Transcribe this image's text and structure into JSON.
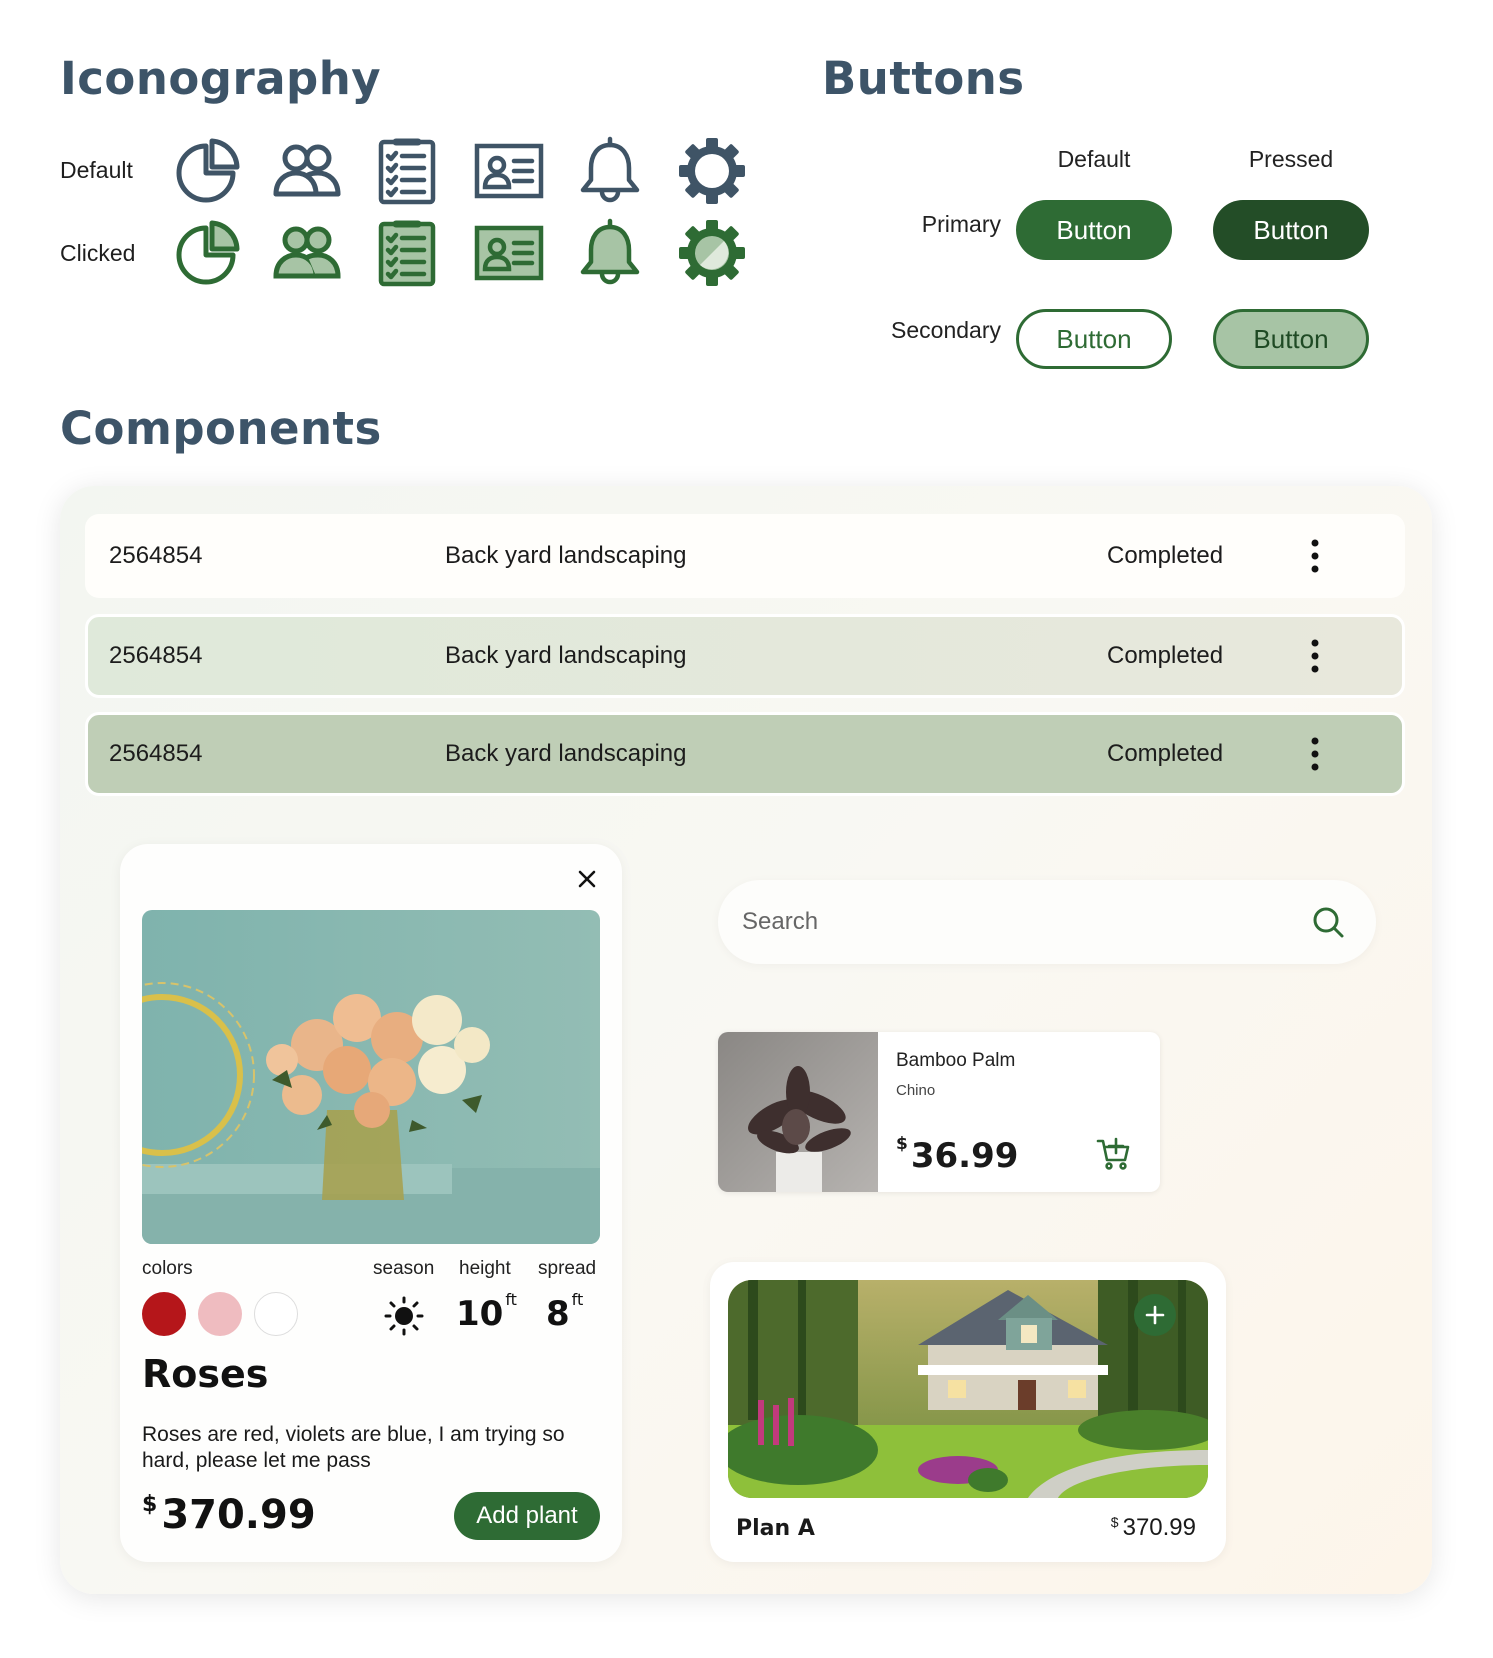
{
  "iconography": {
    "title": "Iconography",
    "rows": [
      {
        "label": "Default",
        "color": "#3f5466"
      },
      {
        "label": "Clicked",
        "color": "#2e6b34"
      }
    ],
    "icons": [
      "pie-chart-icon",
      "users-icon",
      "checklist-icon",
      "contact-card-icon",
      "bell-icon",
      "gear-icon"
    ]
  },
  "buttons": {
    "title": "Buttons",
    "columns": [
      "Default",
      "Pressed"
    ],
    "rows": [
      {
        "label": "Primary",
        "default": "Button",
        "pressed": "Button"
      },
      {
        "label": "Secondary",
        "default": "Button",
        "pressed": "Button"
      }
    ]
  },
  "components": {
    "title": "Components",
    "table_rows": [
      {
        "id": "2564854",
        "title": "Back yard landscaping",
        "status": "Completed",
        "state": "default"
      },
      {
        "id": "2564854",
        "title": "Back yard landscaping",
        "status": "Completed",
        "state": "hover"
      },
      {
        "id": "2564854",
        "title": "Back yard landscaping",
        "status": "Completed",
        "state": "selected"
      }
    ],
    "plant_card": {
      "labels": {
        "colors": "colors",
        "season": "season",
        "height": "height",
        "spread": "spread"
      },
      "colors": [
        "#b5161a",
        "#efbcc0",
        "#ffffff"
      ],
      "season_icon": "sun-icon",
      "height_value": "10",
      "height_unit": "ft",
      "spread_value": "8",
      "spread_unit": "ft",
      "name": "Roses",
      "description": "Roses are red, violets are blue, I am trying so hard, please let me pass",
      "currency": "$",
      "price": "370.99",
      "add_label": "Add plant"
    },
    "search": {
      "placeholder": "Search"
    },
    "product_card": {
      "name": "Bamboo Palm",
      "location": "Chino",
      "currency": "$",
      "price": "36.99"
    },
    "plan_card": {
      "name": "Plan A",
      "currency": "$",
      "price": "370.99"
    }
  },
  "colors": {
    "primary": "#2e6b34",
    "primary_pressed": "#234d27",
    "secondary_pressed": "#a7c4a5",
    "heading": "#3d5468"
  }
}
